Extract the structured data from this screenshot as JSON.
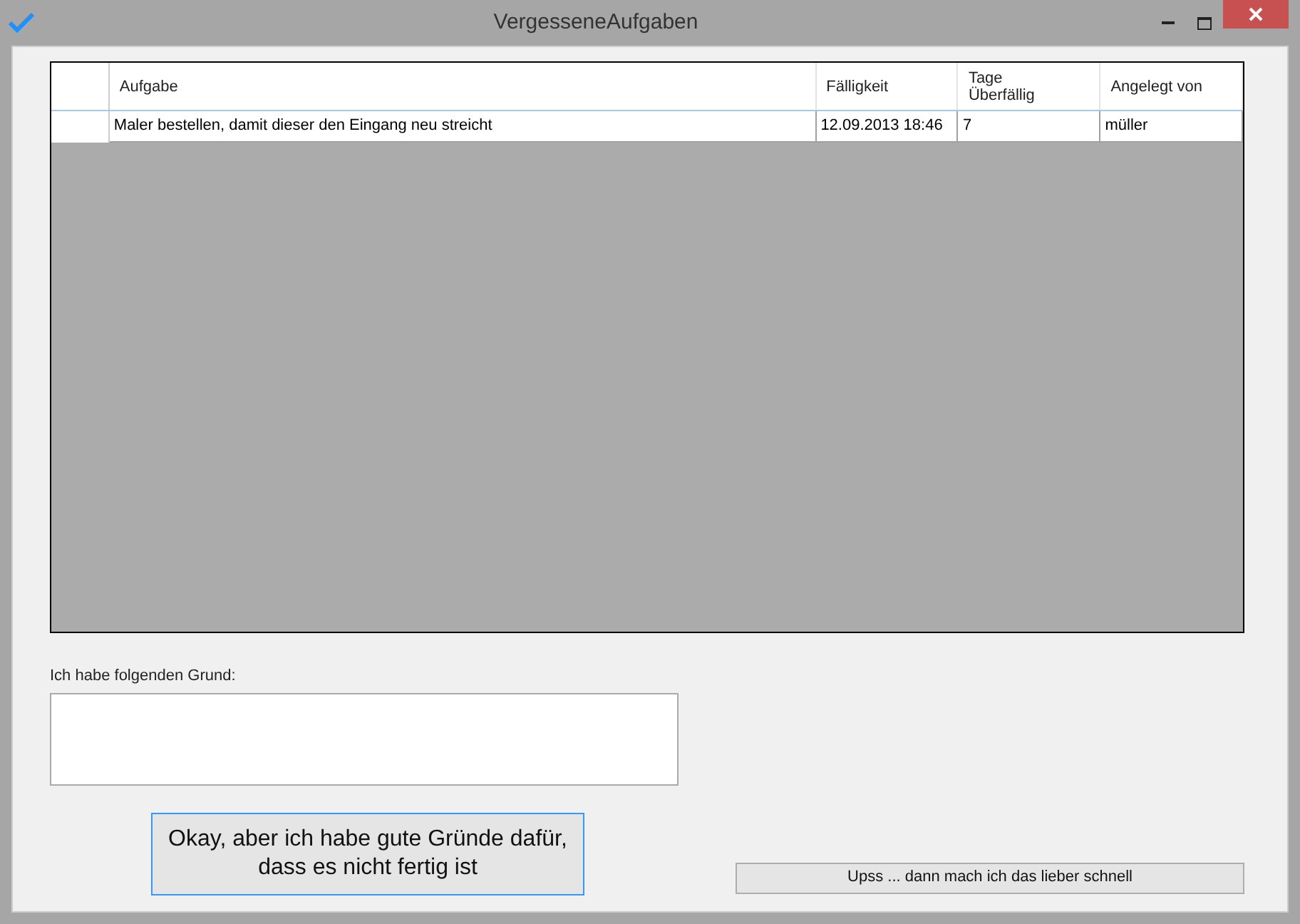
{
  "window": {
    "title": "VergesseneAufgaben"
  },
  "table": {
    "columns": [
      "Aufgabe",
      "Fälligkeit",
      "Tage\nÜberfällig",
      "Angelegt von"
    ],
    "rows": [
      [
        "Maler bestellen, damit dieser den Eingang neu streicht",
        "12.09.2013 18:46",
        "7",
        "müller"
      ]
    ]
  },
  "reason": {
    "label": "Ich habe folgenden Grund:"
  },
  "buttons": [
    {
      "label": "Okay, aber ich habe gute Gründe dafür, dass es nicht fertig ist",
      "kind": "primary"
    },
    {
      "label": "Upss ... dann mach ich das lieber schnell",
      "kind": "secondary"
    }
  ]
}
